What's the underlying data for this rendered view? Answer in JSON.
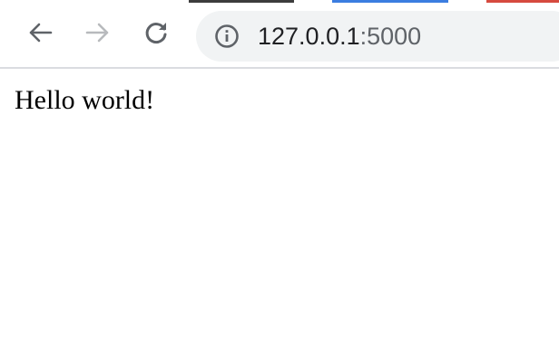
{
  "tab_strip": {
    "colors": [
      "#3c3c3c",
      "#3b7de0",
      "#d64a3f"
    ]
  },
  "toolbar": {
    "back_icon": "arrow-left-icon",
    "forward_icon": "arrow-right-icon",
    "forward_enabled": false,
    "reload_icon": "reload-icon"
  },
  "address_bar": {
    "security_icon": "info-icon",
    "host": "127.0.0.1",
    "port": ":5000"
  },
  "page": {
    "text": "Hello world!"
  }
}
